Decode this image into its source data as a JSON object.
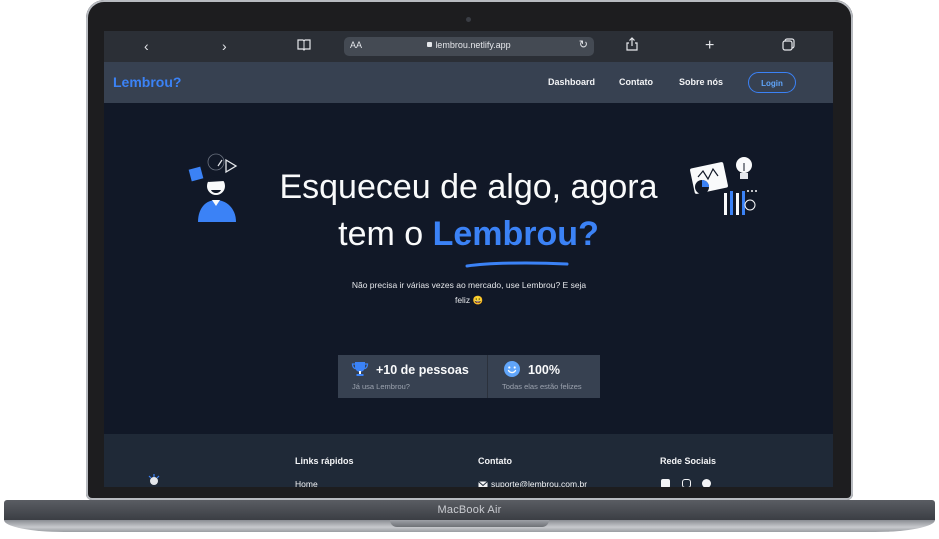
{
  "device": {
    "label": "MacBook Air"
  },
  "browser": {
    "text_size_label": "AA",
    "url": "lembrou.netlify.app",
    "back_icon": "chevron-left-icon",
    "forward_icon": "chevron-right-icon",
    "bookmarks_icon": "book-icon",
    "reload_icon": "reload-icon",
    "share_icon": "share-icon",
    "new_tab_icon": "plus-icon",
    "tabs_icon": "tabs-icon"
  },
  "nav": {
    "brand": "Lembrou?",
    "links": [
      "Dashboard",
      "Contato",
      "Sobre nós"
    ],
    "login": "Login"
  },
  "hero": {
    "title_line1": "Esqueceu de algo, agora",
    "title_line2_prefix": "tem o ",
    "title_accent": "Lembrou?",
    "subtitle_line1": "Não precisa ir várias vezes ao mercado, use Lembrou? E seja",
    "subtitle_line2": "feliz",
    "subtitle_emoji": "😀"
  },
  "stats": [
    {
      "icon": "trophy-icon",
      "value": "+10 de pessoas",
      "label": "Já usa Lembrou?"
    },
    {
      "icon": "smile-icon",
      "value": "100%",
      "label": "Todas elas estão felizes"
    }
  ],
  "footer": {
    "quick_links_heading": "Links rápidos",
    "quick_links": [
      "Home"
    ],
    "contact_heading": "Contato",
    "contact_email": "suporte@lembrou.com.br",
    "social_heading": "Rede Sociais",
    "social_icons": [
      "facebook-icon",
      "instagram-icon",
      "twitter-icon"
    ]
  },
  "colors": {
    "accent": "#3b82f6",
    "page_bg": "#111827",
    "nav_bg": "#374151",
    "footer_bg": "#1f2937"
  }
}
